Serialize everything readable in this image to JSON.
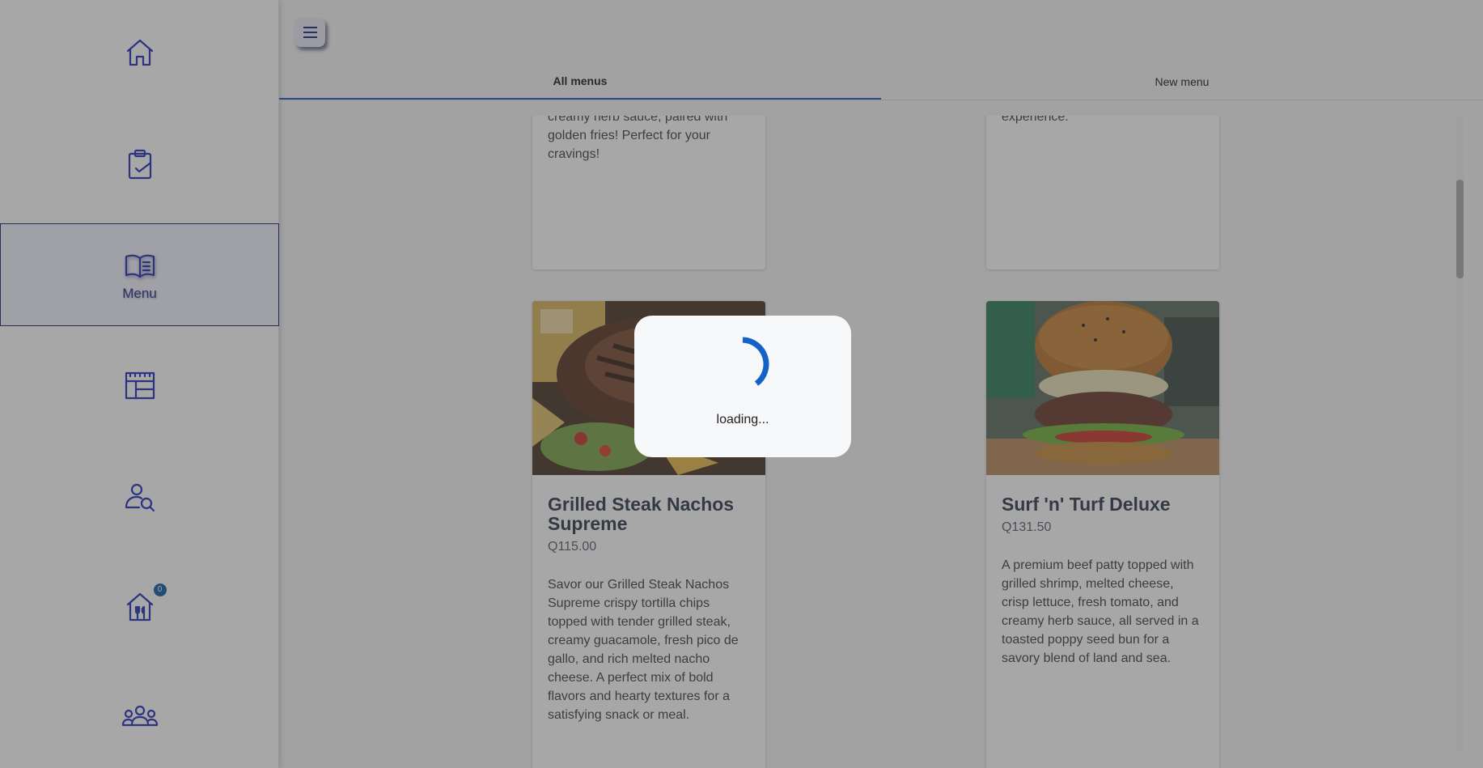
{
  "sidebar": {
    "items": [
      {
        "icon": "home-icon",
        "label": ""
      },
      {
        "icon": "clipboard-check-icon",
        "label": ""
      },
      {
        "icon": "menu-book-icon",
        "label": "Menu"
      },
      {
        "icon": "calendar-table-icon",
        "label": ""
      },
      {
        "icon": "user-search-icon",
        "label": ""
      },
      {
        "icon": "restaurant-icon",
        "label": "",
        "badge": "0"
      },
      {
        "icon": "team-icon",
        "label": ""
      }
    ]
  },
  "header": {
    "tabs": [
      {
        "label": "All menus",
        "active": true
      },
      {
        "label": "New menu",
        "active": false
      }
    ]
  },
  "cards": [
    {
      "description": "creamy herb sauce, paired with golden fries! Perfect for your cravings!"
    },
    {
      "description": "experience."
    },
    {
      "title": "Grilled Steak Nachos Supreme",
      "price": "Q115.00",
      "description": "Savor our Grilled Steak Nachos Supreme crispy tortilla chips topped with tender grilled steak, creamy guacamole, fresh pico de gallo, and rich melted nacho cheese. A perfect mix of bold flavors and hearty textures for a satisfying snack or meal."
    },
    {
      "title": "Surf 'n' Turf Deluxe",
      "price": "Q131.50",
      "description": "A premium beef patty topped with grilled shrimp, melted cheese, crisp lettuce, fresh tomato, and creamy herb sauce, all served in a toasted poppy seed bun for a savory blend of land and sea."
    }
  ],
  "loading": {
    "text": "loading..."
  },
  "colors": {
    "accent": "#1f2fb8",
    "tab_indicator": "#1e54c8",
    "badge": "#0f5aa8"
  }
}
